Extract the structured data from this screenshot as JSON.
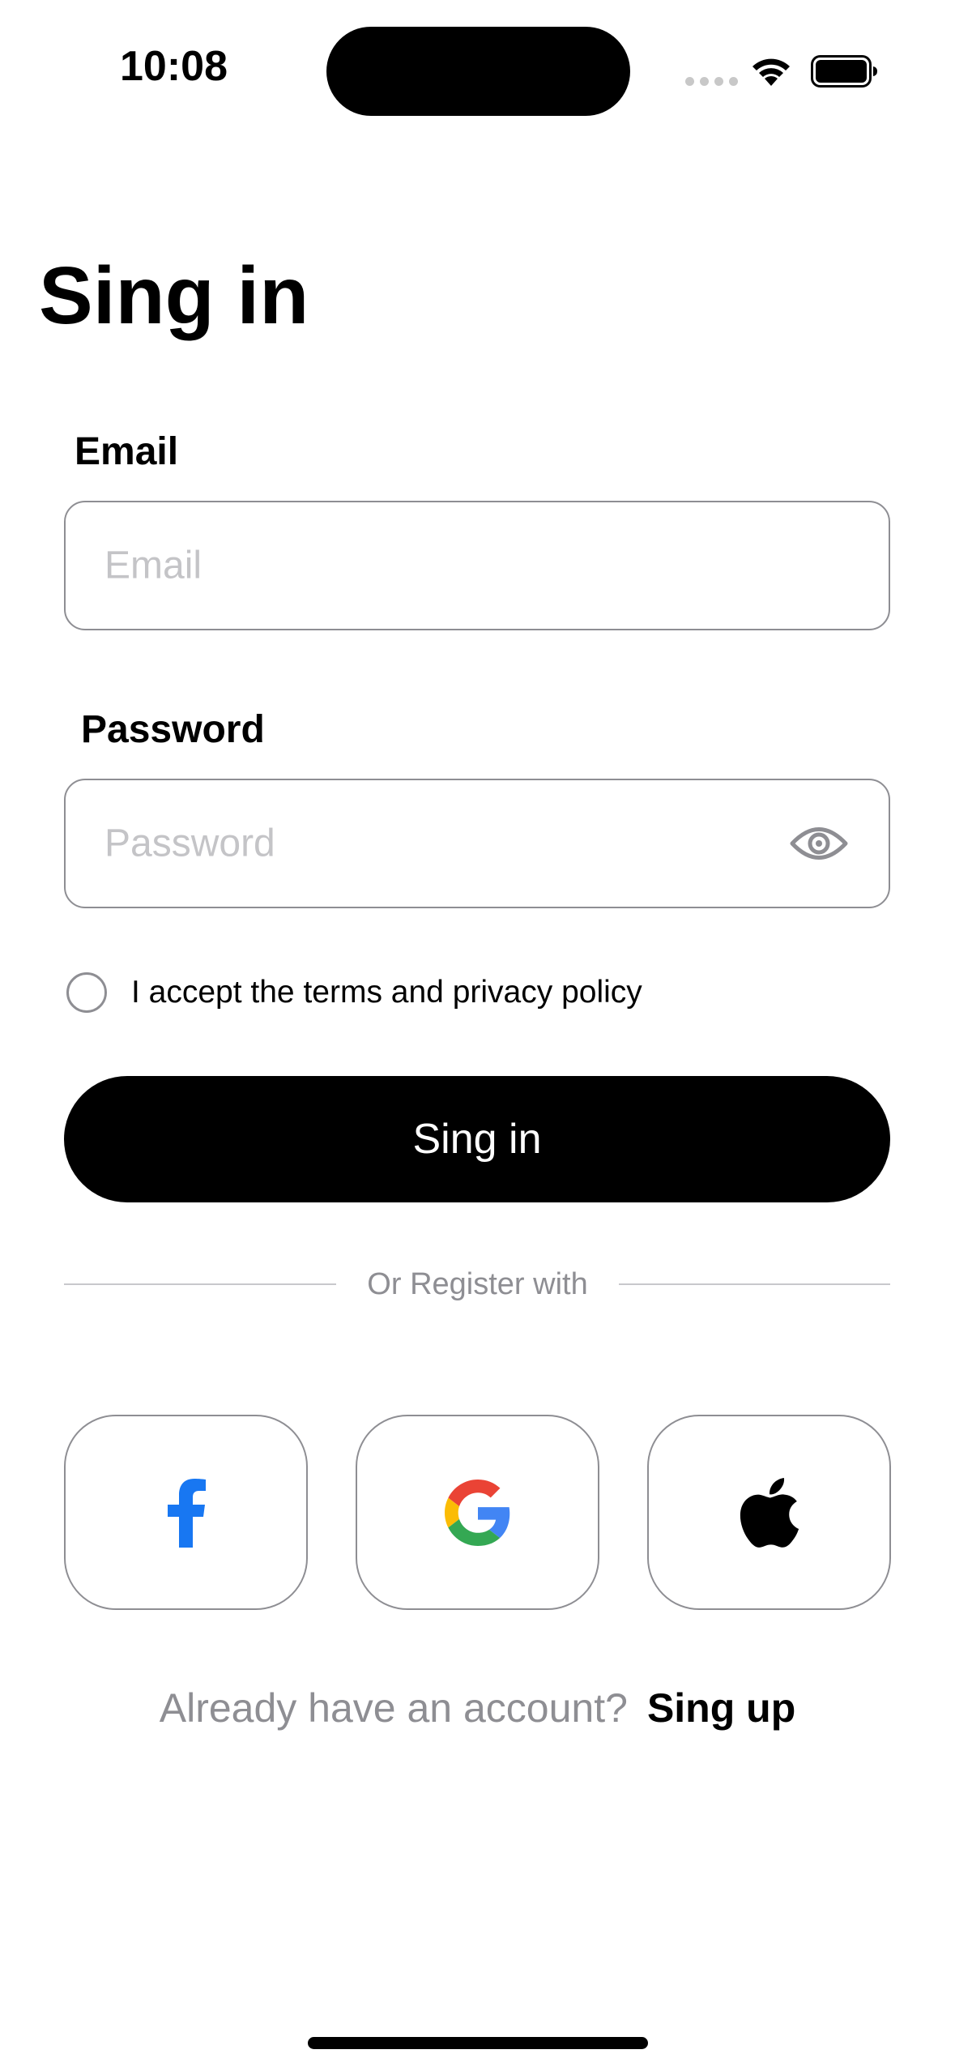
{
  "status_bar": {
    "time": "10:08"
  },
  "page": {
    "title": "Sing in"
  },
  "form": {
    "email_label": "Email",
    "email_placeholder": "Email",
    "email_value": "",
    "password_label": "Password",
    "password_placeholder": "Password",
    "password_value": "",
    "terms_text": "I accept the terms and privacy policy",
    "terms_checked": false,
    "submit_label": "Sing in"
  },
  "divider": {
    "text": "Or Register with"
  },
  "social": {
    "items": [
      {
        "name": "facebook",
        "icon": "facebook-icon",
        "color": "#1877F2"
      },
      {
        "name": "google",
        "icon": "google-icon",
        "colors": [
          "#4285F4",
          "#34A853",
          "#FBBC05",
          "#EA4335"
        ]
      },
      {
        "name": "apple",
        "icon": "apple-icon",
        "color": "#000000"
      }
    ]
  },
  "footer": {
    "question": "Already have an account?",
    "link_label": "Sing up"
  },
  "colors": {
    "accent": "#000000",
    "border": "#8e8e93",
    "placeholder": "#c4c4c7",
    "muted_text": "#8e8e93"
  }
}
